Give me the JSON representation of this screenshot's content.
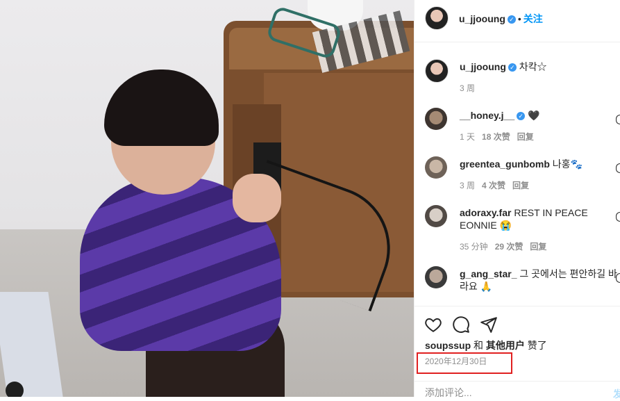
{
  "post": {
    "author": "u_jjooung",
    "follow_label": "关注",
    "caption": "차칵☆",
    "caption_time": "3 周"
  },
  "comments": [
    {
      "user": "__honey.j__",
      "verified": true,
      "text": "🖤",
      "time": "1 天",
      "likes": "18 次赞",
      "reply": "回复"
    },
    {
      "user": "greentea_gunbomb",
      "verified": false,
      "text": "나홍🐾",
      "time": "3 周",
      "likes": "4 次赞",
      "reply": "回复"
    },
    {
      "user": "adoraxy.far",
      "verified": false,
      "text": "REST IN PEACE EONNIE 😭",
      "time": "35 分钟",
      "likes": "29 次赞",
      "reply": "回复"
    },
    {
      "user": "g_ang_star_",
      "verified": false,
      "text": "그 곳에서는 편안하길 바라요 🙏",
      "time": "",
      "likes": "",
      "reply": ""
    }
  ],
  "likes_line": {
    "user": "soupssup",
    "and": "和",
    "others": "其他用户",
    "suffix": "赞了"
  },
  "date": "2020年12月30日",
  "add_comment": {
    "placeholder": "添加评论...",
    "post_label": "发"
  },
  "icons": [
    "verified-badge-icon",
    "heart-icon",
    "comment-icon",
    "share-icon",
    "like-heart-small-icon",
    "user-avatar-icon"
  ],
  "colors": {
    "accent": "#0095f6",
    "verified": "#3897f0",
    "highlight": "#e02020",
    "meta": "#8e8e8e"
  }
}
